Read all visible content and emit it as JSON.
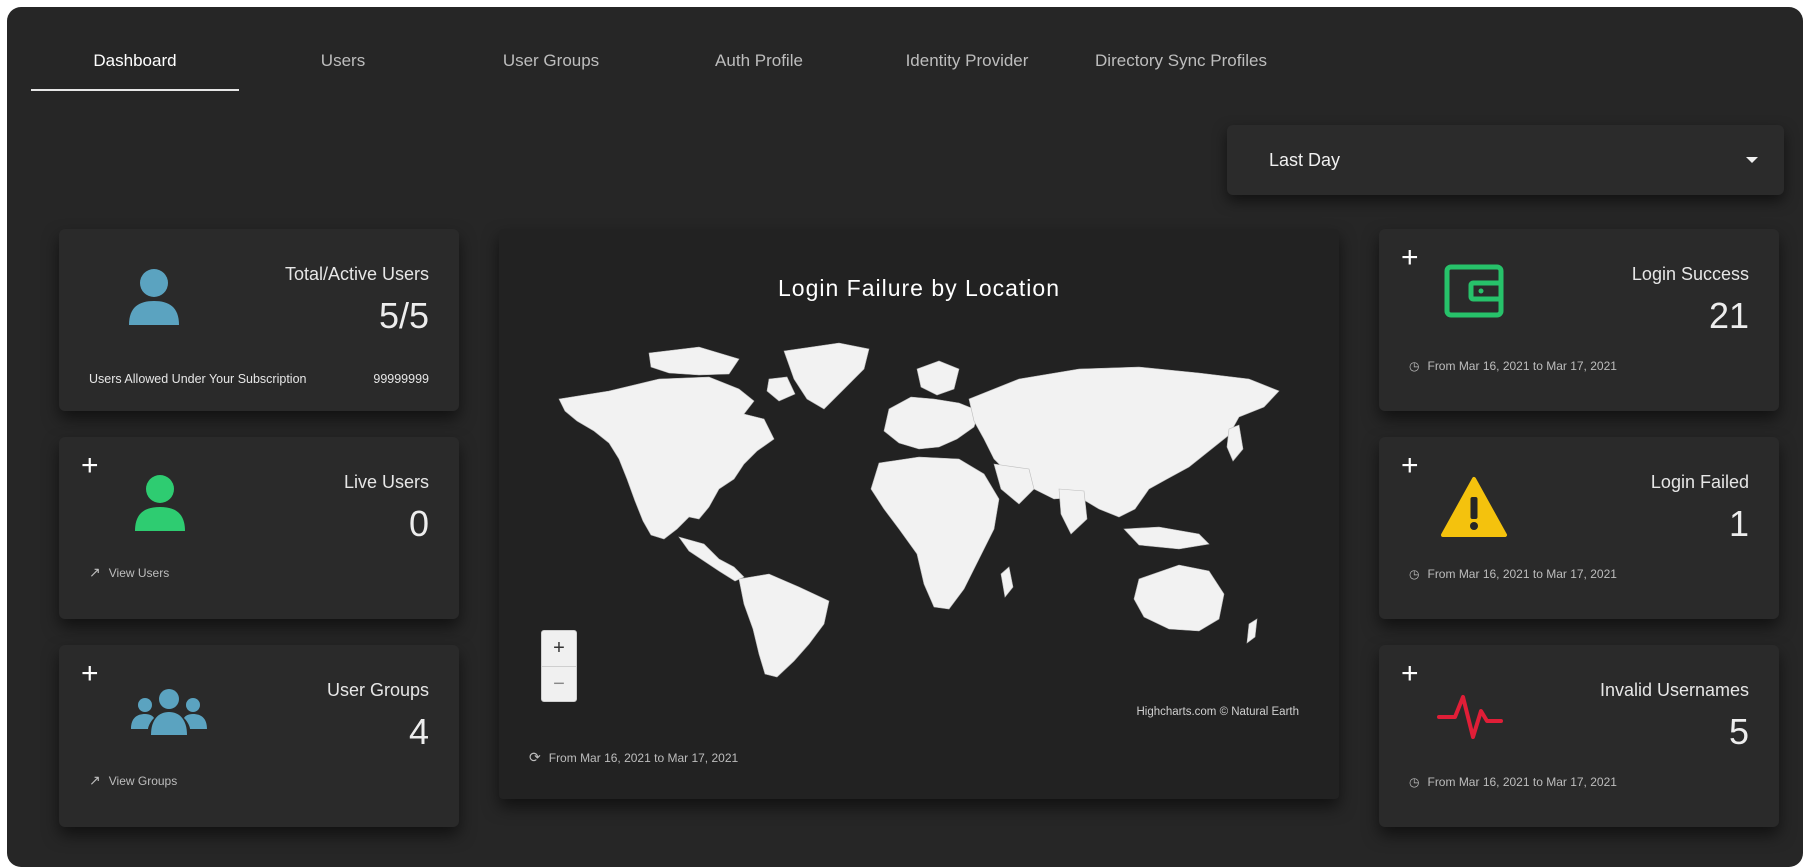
{
  "tabs": [
    {
      "label": "Dashboard",
      "active": true
    },
    {
      "label": "Users",
      "active": false
    },
    {
      "label": "User Groups",
      "active": false
    },
    {
      "label": "Auth Profile",
      "active": false
    },
    {
      "label": "Identity Provider",
      "active": false
    },
    {
      "label": "Directory Sync Profiles",
      "active": false
    }
  ],
  "range_select": {
    "value": "Last Day"
  },
  "cards": {
    "total_users": {
      "title": "Total/Active Users",
      "value": "5/5",
      "sub_label": "Users Allowed Under Your Subscription",
      "sub_value": "99999999",
      "icon": "user-icon"
    },
    "live_users": {
      "title": "Live Users",
      "value": "0",
      "link": "View Users",
      "icon": "user-icon"
    },
    "user_groups": {
      "title": "User Groups",
      "value": "4",
      "link": "View Groups",
      "icon": "users-group-icon"
    },
    "login_success": {
      "title": "Login Success",
      "value": "21",
      "footer": "From Mar 16, 2021 to Mar 17, 2021",
      "icon": "wallet-icon"
    },
    "login_failed": {
      "title": "Login Failed",
      "value": "1",
      "footer": "From Mar 16, 2021 to Mar 17, 2021",
      "icon": "warning-icon"
    },
    "invalid_usernames": {
      "title": "Invalid Usernames",
      "value": "5",
      "footer": "From Mar 16, 2021 to Mar 17, 2021",
      "icon": "pulse-icon"
    }
  },
  "map": {
    "title": "Login Failure by Location",
    "credits": "Highcharts.com © Natural Earth",
    "footer": "From Mar 16, 2021 to Mar 17, 2021",
    "zoom_in": "+",
    "zoom_out": "−"
  },
  "plus_label": "+",
  "colors": {
    "background": "#262626",
    "card": "#2a2a2a",
    "user_blue": "#5ba3c0",
    "live_green": "#2ecc71",
    "success_green": "#27c26a",
    "warning_yellow": "#f4c20d",
    "invalid_red": "#e01e37"
  }
}
